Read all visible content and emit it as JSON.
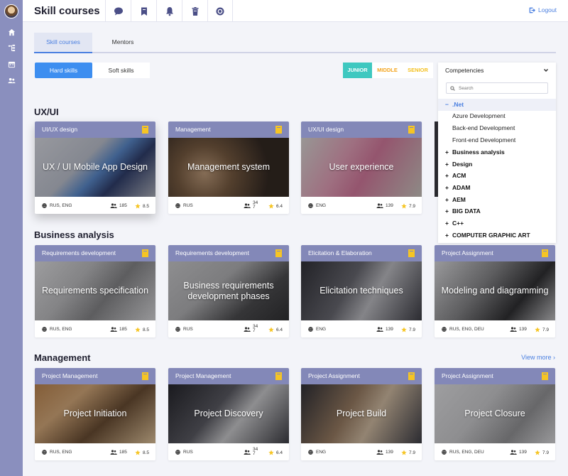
{
  "header": {
    "title": "Skill courses",
    "logout_label": "Logout"
  },
  "tabs": [
    {
      "label": "Skill courses",
      "active": true
    },
    {
      "label": "Mentors",
      "active": false
    }
  ],
  "skill_toggle": [
    {
      "label": "Hard skills",
      "active": true
    },
    {
      "label": "Soft skills",
      "active": false
    }
  ],
  "levels": [
    {
      "label": "JUNIOR",
      "active": true
    },
    {
      "label": "MIDDLE",
      "active": false
    },
    {
      "label": "SENIOR",
      "active": false
    }
  ],
  "competencies": {
    "label": "Competencies",
    "search_placeholder": "Search",
    "items": [
      {
        "sign": "−",
        "label": ".Net",
        "expanded": true
      },
      {
        "label": "Azure Development",
        "child": true
      },
      {
        "label": "Back-end Development",
        "child": true
      },
      {
        "label": "Front-end Development",
        "child": true
      },
      {
        "sign": "+",
        "label": "Business analysis"
      },
      {
        "sign": "+",
        "label": "Design"
      },
      {
        "sign": "+",
        "label": "ACM"
      },
      {
        "sign": "+",
        "label": "ADAM"
      },
      {
        "sign": "+",
        "label": "AEM"
      },
      {
        "sign": "+",
        "label": "BIG DATA"
      },
      {
        "sign": "+",
        "label": "C++"
      },
      {
        "sign": "+",
        "label": "COMPUTER GRAPHIC ART"
      }
    ]
  },
  "sections": [
    {
      "title": "UX/UI",
      "cards": [
        {
          "category": "UI/UX design",
          "title": "UX / UI Mobile App Design",
          "langs": "RUS, ENG",
          "count": "185",
          "rating": "8.5"
        },
        {
          "category": "Management",
          "title": "Management system",
          "langs": "RUS",
          "count": "347",
          "rating": "6.4"
        },
        {
          "category": "UX/UI design",
          "title": "User experience",
          "langs": "ENG",
          "count": "139",
          "rating": "7.9"
        }
      ]
    },
    {
      "title": "Business analysis",
      "cards": [
        {
          "category": "Requirements development",
          "title": "Requirements specification",
          "langs": "RUS, ENG",
          "count": "185",
          "rating": "8.5"
        },
        {
          "category": "Requirements development",
          "title": "Business requirements development phases",
          "langs": "RUS",
          "count": "347",
          "rating": "6.4"
        },
        {
          "category": "Elicitation & Elaboration",
          "title": "Elicitation techniques",
          "langs": "ENG",
          "count": "139",
          "rating": "7.9"
        },
        {
          "category": "Project Assignment",
          "title": "Modeling and diagramming",
          "langs": "RUS, ENG, DEU",
          "count": "139",
          "rating": "7.9"
        }
      ]
    },
    {
      "title": "Management",
      "view_more": "View more ›",
      "cards": [
        {
          "category": "Project Management",
          "title": "Project Initiation",
          "langs": "RUS, ENG",
          "count": "185",
          "rating": "8.5"
        },
        {
          "category": "Project Management",
          "title": "Project Discovery",
          "langs": "RUS",
          "count": "347",
          "rating": "6.4"
        },
        {
          "category": "Project Assignment",
          "title": "Project Build",
          "langs": "ENG",
          "count": "139",
          "rating": "7.9"
        },
        {
          "category": "Project Assignment",
          "title": "Project Closure",
          "langs": "RUS, ENG, DEU",
          "count": "139",
          "rating": "7.9"
        }
      ]
    }
  ]
}
